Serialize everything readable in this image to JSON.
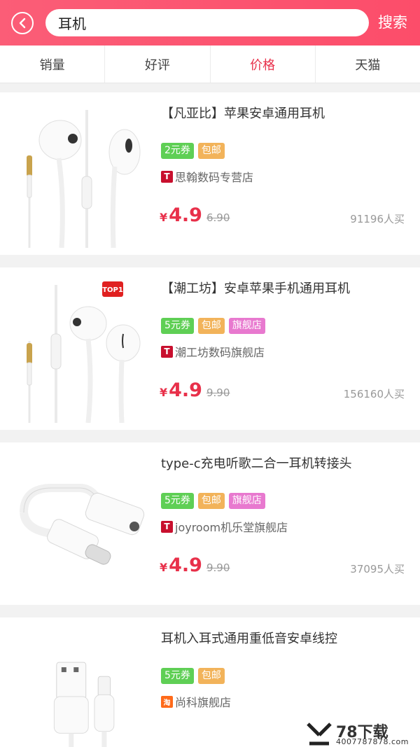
{
  "header": {
    "search_value": "耳机",
    "search_button": "搜索"
  },
  "tabs": [
    {
      "label": "销量",
      "active": false
    },
    {
      "label": "好评",
      "active": false
    },
    {
      "label": "价格",
      "active": true
    },
    {
      "label": "天猫",
      "active": false
    }
  ],
  "products": [
    {
      "title": "【凡亚比】苹果安卓通用耳机",
      "tags": [
        "2元券",
        "包邮"
      ],
      "shop": "思翰数码专营店",
      "shop_icon": "T",
      "currency": "¥",
      "price": "4.9",
      "original_price": "6.90",
      "sales": "91196人买",
      "image": "white-earphones-icon"
    },
    {
      "title": "【潮工坊】安卓苹果手机通用耳机",
      "tags": [
        "5元券",
        "包邮",
        "旗舰店"
      ],
      "shop": "潮工坊数码旗舰店",
      "shop_icon": "T",
      "badge": "TOP1",
      "currency": "¥",
      "price": "4.9",
      "original_price": "9.90",
      "sales": "156160人买",
      "image": "white-earphones-icon"
    },
    {
      "title": "type-c充电听歌二合一耳机转接头",
      "tags": [
        "5元券",
        "包邮",
        "旗舰店"
      ],
      "shop": "joyroom机乐堂旗舰店",
      "shop_icon": "T",
      "currency": "¥",
      "price": "4.9",
      "original_price": "9.90",
      "sales": "37095人买",
      "image": "typec-adapter-icon"
    },
    {
      "title": "耳机入耳式通用重低音安卓线控",
      "tags": [
        "5元券",
        "包邮"
      ],
      "shop": "尚科旗舰店",
      "shop_icon": "淘",
      "image": "usb-cable-icon"
    }
  ],
  "watermark": {
    "brand": "78下载",
    "phone": "4007787878.com"
  },
  "colors": {
    "header": "#fc4d6a",
    "accent": "#e8304a",
    "tag_green": "#5fcf55",
    "tag_orange": "#f2b35a",
    "tag_pink": "#e879cf",
    "shop_tmall": "#c8102e",
    "shop_taobao": "#ff6a1a"
  }
}
